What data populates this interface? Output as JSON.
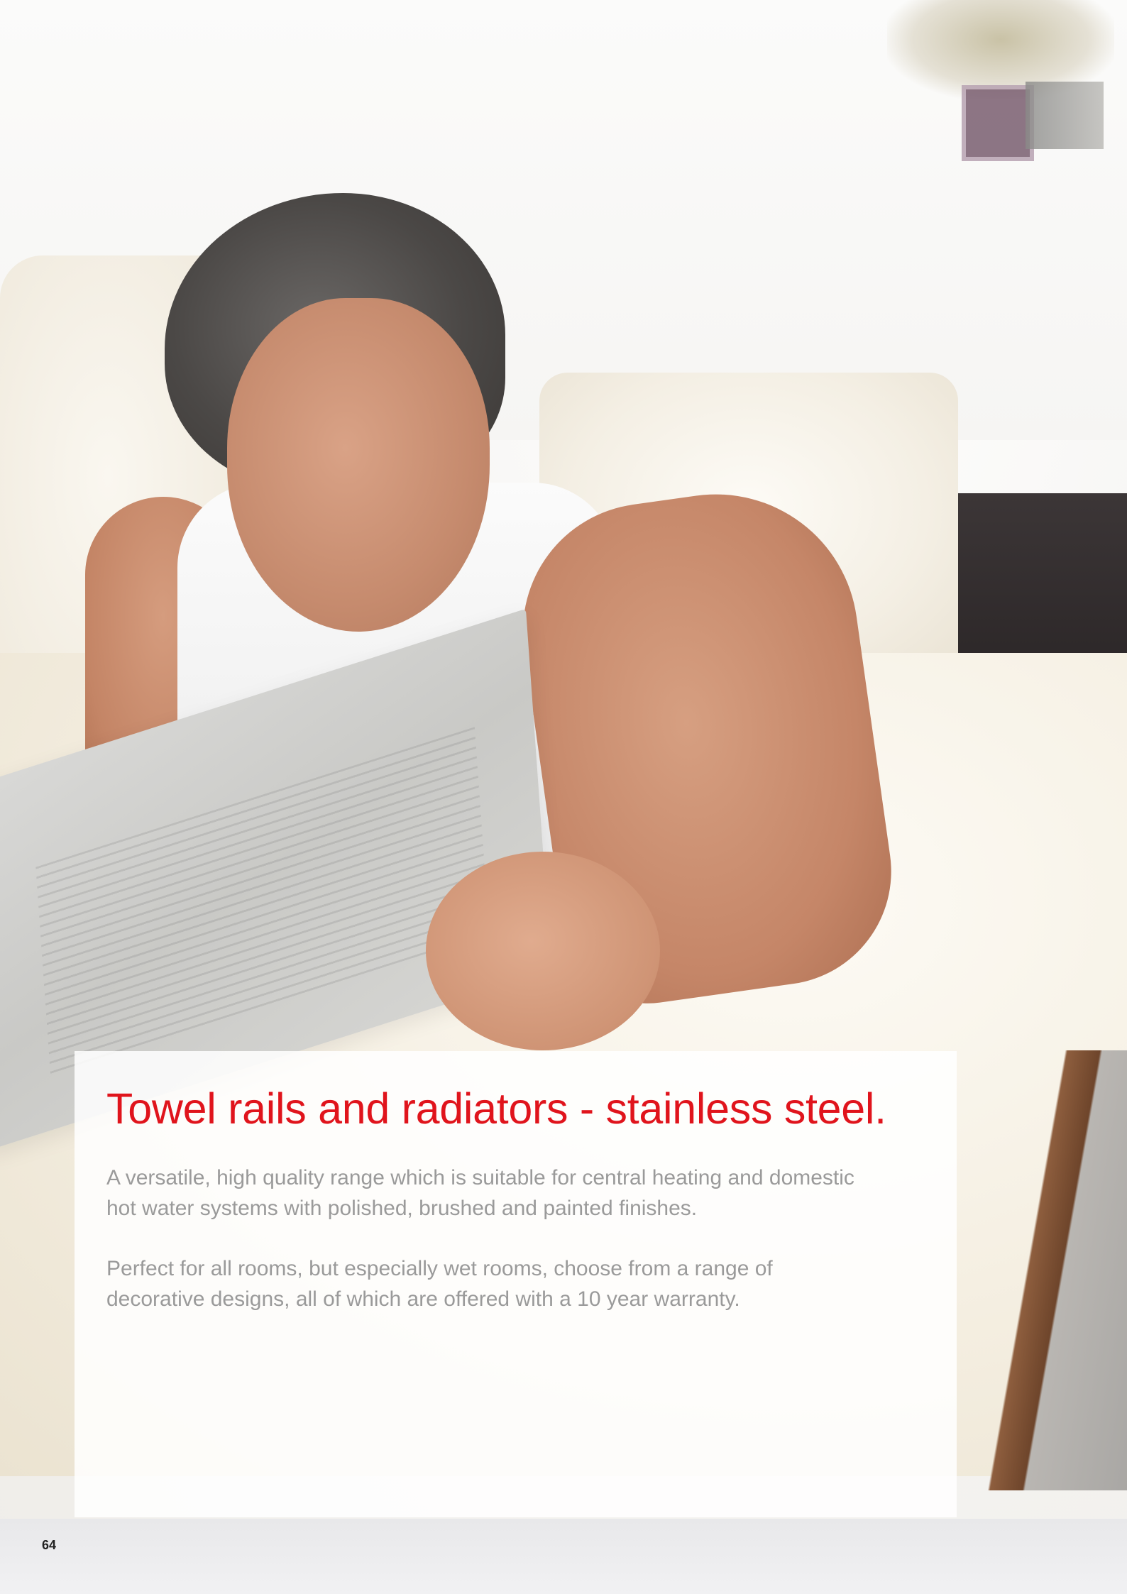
{
  "brochure": {
    "headline": "Towel rails and radiators - stainless steel.",
    "paragraph_1": [
      "A versatile, high quality range which is suitable for central heating and domestic",
      "hot water systems with polished, brushed and painted finishes."
    ],
    "paragraph_2": [
      "Perfect for all rooms, but especially wet rooms, choose from a range of",
      "decorative designs, all of which are offered with a 10 year warranty."
    ],
    "page_number": "64"
  },
  "colors": {
    "headline": "#e0141c",
    "body_text": "#9a9a9a",
    "panel": "#ffffff",
    "page_number": "#222222"
  },
  "photo": {
    "icon": "photo-man-reading-newspaper-in-bed"
  }
}
